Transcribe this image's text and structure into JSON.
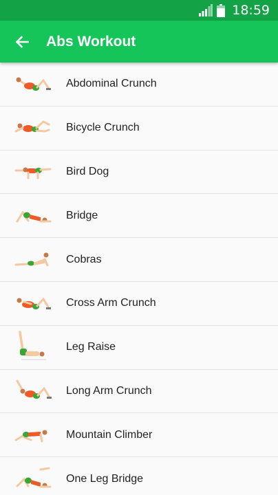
{
  "status_bar": {
    "time": "18:59",
    "icons": [
      "signal-icon",
      "battery-icon"
    ]
  },
  "app_bar": {
    "title": "Abs Workout",
    "back_icon": "arrow-back-icon"
  },
  "colors": {
    "status_bar": "#13a346",
    "app_bar": "#16c55a",
    "shorts": "#3aa636",
    "shirt": "#f05a28",
    "skin": "#f2c9a0"
  },
  "exercises": [
    {
      "label": "Abdominal Crunch",
      "icon": "abdominal-crunch-illustration"
    },
    {
      "label": "Bicycle Crunch",
      "icon": "bicycle-crunch-illustration"
    },
    {
      "label": "Bird Dog",
      "icon": "bird-dog-illustration"
    },
    {
      "label": "Bridge",
      "icon": "bridge-illustration"
    },
    {
      "label": "Cobras",
      "icon": "cobras-illustration"
    },
    {
      "label": "Cross Arm Crunch",
      "icon": "cross-arm-crunch-illustration"
    },
    {
      "label": "Leg Raise",
      "icon": "leg-raise-illustration"
    },
    {
      "label": "Long Arm Crunch",
      "icon": "long-arm-crunch-illustration"
    },
    {
      "label": "Mountain Climber",
      "icon": "mountain-climber-illustration"
    },
    {
      "label": "One Leg Bridge",
      "icon": "one-leg-bridge-illustration"
    }
  ]
}
